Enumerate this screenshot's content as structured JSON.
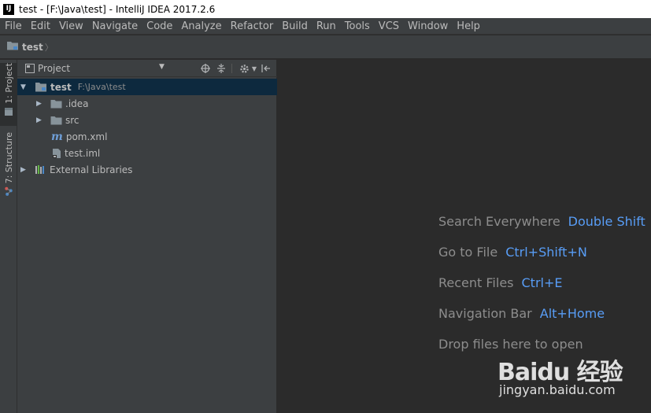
{
  "window": {
    "icon_text": "IJ",
    "title": "test - [F:\\Java\\test] - IntelliJ IDEA 2017.2.6"
  },
  "menu": [
    "File",
    "Edit",
    "View",
    "Navigate",
    "Code",
    "Analyze",
    "Refactor",
    "Build",
    "Run",
    "Tools",
    "VCS",
    "Window",
    "Help"
  ],
  "navbar": {
    "breadcrumb": "test"
  },
  "left_stripe": {
    "project_tab": "1: Project",
    "structure_tab": "7: Structure"
  },
  "project_panel": {
    "title": "Project",
    "tools": [
      "target-icon",
      "collapse-icon",
      "gear-icon",
      "hide-icon"
    ],
    "tree": {
      "root": {
        "name": "test",
        "path": "F:\\Java\\test"
      },
      "idea": ".idea",
      "src": "src",
      "pom": "pom.xml",
      "iml": "test.iml",
      "libs": "External Libraries"
    }
  },
  "editor": {
    "hints": [
      {
        "label": "Search Everywhere",
        "key": "Double Shift"
      },
      {
        "label": "Go to File",
        "key": "Ctrl+Shift+N"
      },
      {
        "label": "Recent Files",
        "key": "Ctrl+E"
      },
      {
        "label": "Navigation Bar",
        "key": "Alt+Home"
      },
      {
        "label": "Drop files here to open",
        "key": ""
      }
    ]
  },
  "watermark": {
    "logo": "Baidu 经验",
    "url": "jingyan.baidu.com"
  },
  "colors": {
    "editor_bg": "#2b2b2b",
    "panel_bg": "#3c3f41",
    "selection": "#0d293e",
    "shortcut": "#589df6"
  }
}
